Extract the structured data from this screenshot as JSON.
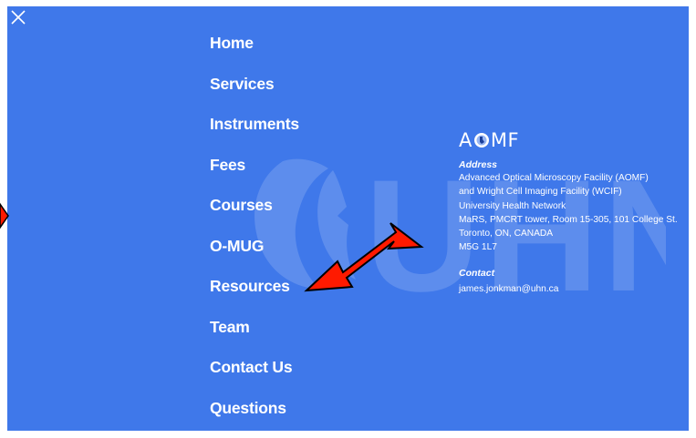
{
  "menu": {
    "close_label": "×",
    "items": [
      {
        "label": "Home"
      },
      {
        "label": "Services"
      },
      {
        "label": "Instruments"
      },
      {
        "label": "Fees"
      },
      {
        "label": "Courses"
      },
      {
        "label": "O-MUG"
      },
      {
        "label": "Resources"
      },
      {
        "label": "Team"
      },
      {
        "label": "Contact Us"
      },
      {
        "label": "Questions"
      }
    ]
  },
  "brand": {
    "prefix": "A",
    "suffix": "MF"
  },
  "watermark": {
    "text": "UHN"
  },
  "address": {
    "title": "Address",
    "lines": [
      "Advanced Optical Microscopy Facility (AOMF)",
      "and Wright Cell Imaging Facility (WCIF)",
      "University Health Network",
      "MaRS, PMCRT tower, Room 15-305, 101 College St.",
      "Toronto, ON, CANADA",
      "M5G 1L7"
    ]
  },
  "contact": {
    "title": "Contact",
    "email": "james.jonkman@uhn.ca"
  },
  "colors": {
    "background": "#3f78ea",
    "text": "#ffffff",
    "arrow": "#ff0000"
  }
}
